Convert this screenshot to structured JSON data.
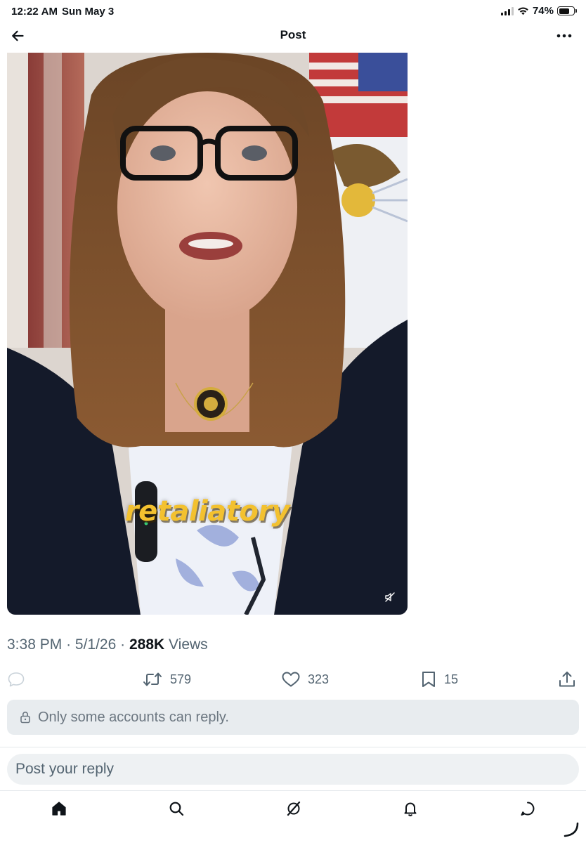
{
  "status_bar": {
    "time": "12:22 AM",
    "date": "Sun May 3",
    "battery": "74%",
    "battery_level": 0.74
  },
  "header": {
    "title": "Post",
    "back_icon": "arrow-left-icon",
    "more_icon": "more-horizontal-icon"
  },
  "media": {
    "caption_word": "retaliatory",
    "mute_icon": "speaker-muted-icon"
  },
  "meta": {
    "time": "3:38 PM",
    "separator": "·",
    "date": "5/1/26",
    "views_count": "288K",
    "views_label": "Views"
  },
  "actions": {
    "reply": {
      "icon": "reply-bubble-icon",
      "count": ""
    },
    "repost": {
      "icon": "repost-icon",
      "count": "579"
    },
    "like": {
      "icon": "heart-icon",
      "count": "323"
    },
    "bookmark": {
      "icon": "bookmark-icon",
      "count": "15"
    },
    "share": {
      "icon": "share-icon"
    }
  },
  "reply_notice": {
    "icon": "lock-icon",
    "text": "Only some accounts can reply."
  },
  "reply_box": {
    "placeholder": "Post your reply"
  },
  "nav": {
    "items": [
      "home-icon",
      "search-icon",
      "grok-icon",
      "notifications-bell-icon",
      "messages-icon"
    ]
  },
  "colors": {
    "text_primary": "#0f1419",
    "text_secondary": "#536471",
    "notice_bg": "#e8ecef",
    "caption_yellow": "#f3c12f"
  }
}
